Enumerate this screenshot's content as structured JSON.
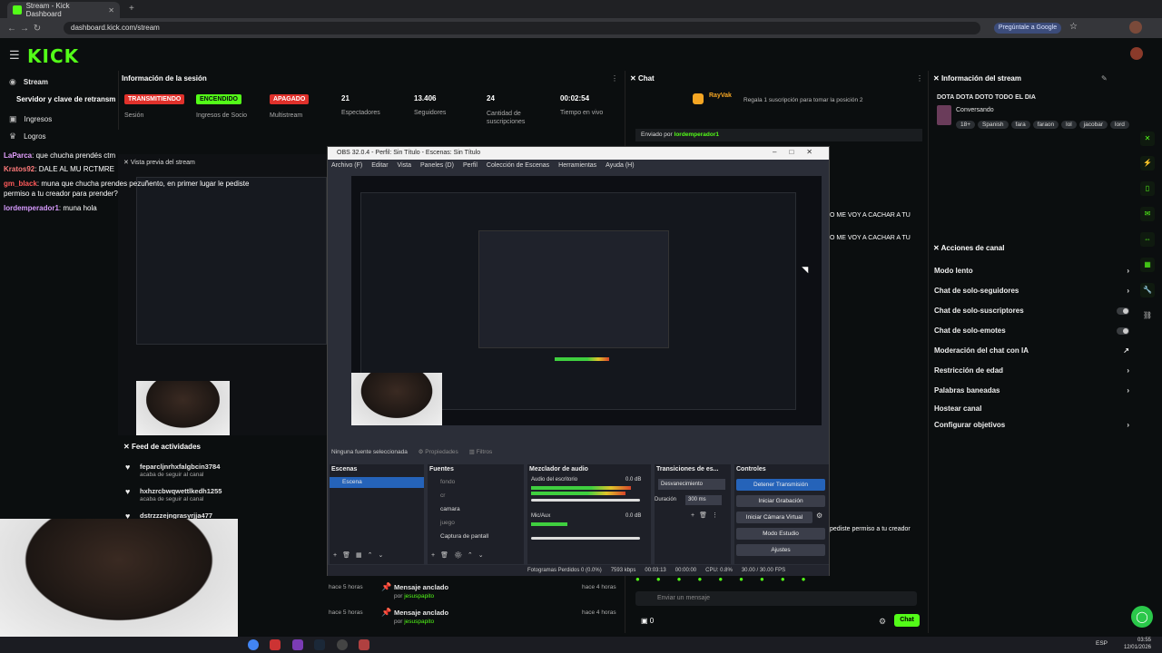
{
  "browser": {
    "tab_title": "Stream - Kick Dashboard",
    "url": "dashboard.kick.com/stream",
    "google_button": "Pregúntale a Google"
  },
  "kick": {
    "logo": "KICK"
  },
  "sidebar": {
    "items": [
      {
        "label": "Stream",
        "icon": "broadcast-icon"
      },
      {
        "label": "Ingresos",
        "icon": "money-icon"
      },
      {
        "label": "Logros",
        "icon": "trophy-icon"
      }
    ],
    "overflow_label": "Servidor y clave de retransm"
  },
  "session": {
    "title": "Información de la sesión",
    "stats": [
      {
        "badge": "TRANSMITIENDO",
        "label": "Sesión",
        "color": "#e0312b"
      },
      {
        "badge": "ENCENDIDO",
        "label": "Ingresos de Socio",
        "color": "#53fc18"
      },
      {
        "badge": "APAGADO",
        "label": "Multistream",
        "color": "#e0312b"
      },
      {
        "value": "21",
        "label": "Espectadores"
      },
      {
        "value": "13.406",
        "label": "Seguidores"
      },
      {
        "value": "24",
        "label": "Cantidad de suscripciones"
      },
      {
        "value": "00:02:54",
        "label": "Tiempo en vivo"
      }
    ]
  },
  "preview": {
    "title": "Vista previa del stream"
  },
  "overlay_chat": [
    {
      "user": "LaParca",
      "text": ": que chucha prendés ctm"
    },
    {
      "user": "Kratos92",
      "text": ": DALE AL MU RCTMRE"
    },
    {
      "user": "gm_black",
      "text": ": muna que chucha prendes pezuñento, en primer lugar le pediste permiso a tu creador para prender?"
    },
    {
      "user": "lordemperador1",
      "text": ": muna hola"
    }
  ],
  "activity": {
    "title": "Feed de actividades",
    "items": [
      {
        "user": "feparcljnrhxfalgbcin3784",
        "text": "acaba de seguir al canal"
      },
      {
        "user": "hxhzrcbwqwettlkedh1255",
        "text": "acaba de seguir al canal"
      },
      {
        "user": "dstrzzzejngrasyrjja477",
        "text": "acaba de seguir al canal"
      }
    ]
  },
  "pinned": [
    {
      "title": "Mensaje anclado",
      "by": "por",
      "user": "jesuspapito",
      "time_left": "hace 5 horas",
      "time_right": "hace 4 horas"
    },
    {
      "title": "Mensaje anclado",
      "by": "por",
      "user": "jesuspapito",
      "time_left": "hace 5 horas",
      "time_right": "hace 4 horas"
    }
  ],
  "chat": {
    "title": "Chat",
    "gift_user": "RayVak",
    "gift_text": "Regala 1 suscripción para tomar la posición 2",
    "sent_by": "Enviado por",
    "sent_user": "lordemperador1",
    "partial_lines": [
      "O ME VOY A CACHAR A TU",
      "O ME VOY A CACHAR A TU",
      "pediste permiso a tu creador"
    ],
    "input_placeholder": "Enviar un mensaje",
    "send_label": "Chat",
    "count": "0"
  },
  "stream_info": {
    "title": "Información del stream",
    "stream_title": "DOTA DOTA DOTO TODO EL DIA",
    "category": "Conversando",
    "tags": [
      "18+",
      "Spanish",
      "fara",
      "faraon",
      "lol",
      "jacobar",
      "lord"
    ]
  },
  "actions": {
    "title": "Acciones de canal",
    "items": [
      {
        "label": "Modo lento",
        "control": "chevron"
      },
      {
        "label": "Chat de solo-seguidores",
        "control": "chevron"
      },
      {
        "label": "Chat de solo-suscriptores",
        "control": "toggle"
      },
      {
        "label": "Chat de solo-emotes",
        "control": "toggle"
      },
      {
        "label": "Moderación del chat con IA",
        "control": "link"
      },
      {
        "label": "Restricción de edad",
        "control": "chevron"
      },
      {
        "label": "Palabras baneadas",
        "control": "chevron"
      },
      {
        "label": "Hostear canal",
        "control": "none"
      },
      {
        "label": "Configurar objetivos",
        "control": "chevron"
      }
    ]
  },
  "obs": {
    "title": "OBS 32.0.4 - Perfil: Sin Título - Escenas: Sin Título",
    "menu": [
      "Archivo (F)",
      "Editar",
      "Vista",
      "Paneles (D)",
      "Perfil",
      "Colección de Escenas",
      "Herramientas",
      "Ayuda (H)"
    ],
    "no_source": "Ninguna fuente seleccionada",
    "properties": "Propiedades",
    "filters": "Filtros",
    "docks": {
      "scenes": "Escenas",
      "sources": "Fuentes",
      "mixer": "Mezclador de audio",
      "transitions": "Transiciones de es...",
      "controls": "Controles"
    },
    "scene_items": [
      "Escena"
    ],
    "source_items": [
      "fondo",
      "cr",
      "camara",
      "juego",
      "Captura de pantall"
    ],
    "mixer_channels": [
      {
        "name": "Audio del escritorio",
        "db": "0.0 dB"
      },
      {
        "name": "Mic/Aux",
        "db": "0.0 dB"
      }
    ],
    "transition": "Desvanecimiento",
    "duration_label": "Duración",
    "duration": "300 ms",
    "controls": [
      "Detener Transmisión",
      "Iniciar Grabación",
      "Iniciar Cámara Virtual",
      "Modo Estudio",
      "Ajustes"
    ],
    "status": {
      "frames_lost": "Fotogramas Perdidos 0 (0.0%)",
      "bitrate": "7593 kbps",
      "time": "00:03:13",
      "rec": "00:00:00",
      "cpu": "CPU: 0.8%",
      "fps": "30.00 / 30.00 FPS"
    }
  },
  "taskbar": {
    "lang": "ESP",
    "time": "03:55",
    "date": "12/01/2026"
  }
}
